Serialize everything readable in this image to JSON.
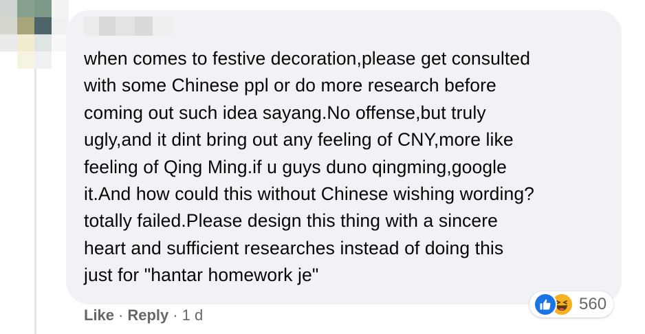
{
  "avatar": {
    "pixels": [
      "#cfd6d2",
      "#86a28f",
      "#7d9a88",
      "#f2f4f2",
      "#d4d8cf",
      "#a9a57a",
      "#4e6469",
      "#eef1ef",
      "#e9ecea",
      "#f2ecd0",
      "#dfe5e3",
      "#f7f8f7",
      "#ffffff",
      "#f6f3e3",
      "#eff1f2",
      "#ffffff"
    ]
  },
  "author": {
    "blur_colors": [
      "#ececec",
      "#d9d9d9",
      "#e3e3e3",
      "#dadada",
      "#efefef"
    ]
  },
  "comment": {
    "text": "when comes to festive decoration,please get consulted\nwith some Chinese ppl or do more research before\ncoming out such idea sayang.No offense,but truly\nugly,and it dint bring out any feeling of CNY,more like\nfeeling of Qing Ming.if u guys duno qingming,google\nit.And how could this without Chinese wishing wording?\ntotally failed.Please design this thing with a sincere\nheart and sufficient researches instead of doing this\njust for \"hantar homework je\""
  },
  "reactions": {
    "icons": [
      "like-reaction",
      "haha-reaction"
    ],
    "count": "560",
    "like_color": "#1b74e4",
    "haha_color": "#f7b125"
  },
  "actions": {
    "like_label": "Like",
    "reply_label": "Reply",
    "separator": "·",
    "timestamp": "1 d"
  },
  "colors": {
    "bubble": "#f0f2f5",
    "text": "#050505",
    "secondary": "#65676b"
  }
}
